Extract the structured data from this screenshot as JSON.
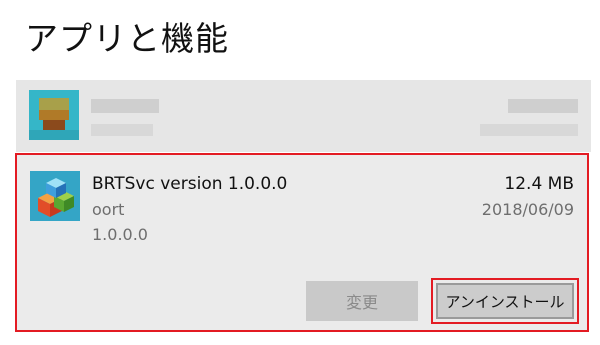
{
  "page": {
    "title": "アプリと機能"
  },
  "selected_app": {
    "name": "BRTSvc version 1.0.0.0",
    "publisher": "oort",
    "version": "1.0.0.0",
    "size": "12.4 MB",
    "date": "2018/06/09",
    "icon": "colored-cubes-icon"
  },
  "actions": {
    "modify_label": "変更",
    "uninstall_label": "アンインストール"
  },
  "colors": {
    "highlight_border": "#e31b23",
    "item_background": "#ebebeb",
    "icon_background": "#34a5c6"
  }
}
